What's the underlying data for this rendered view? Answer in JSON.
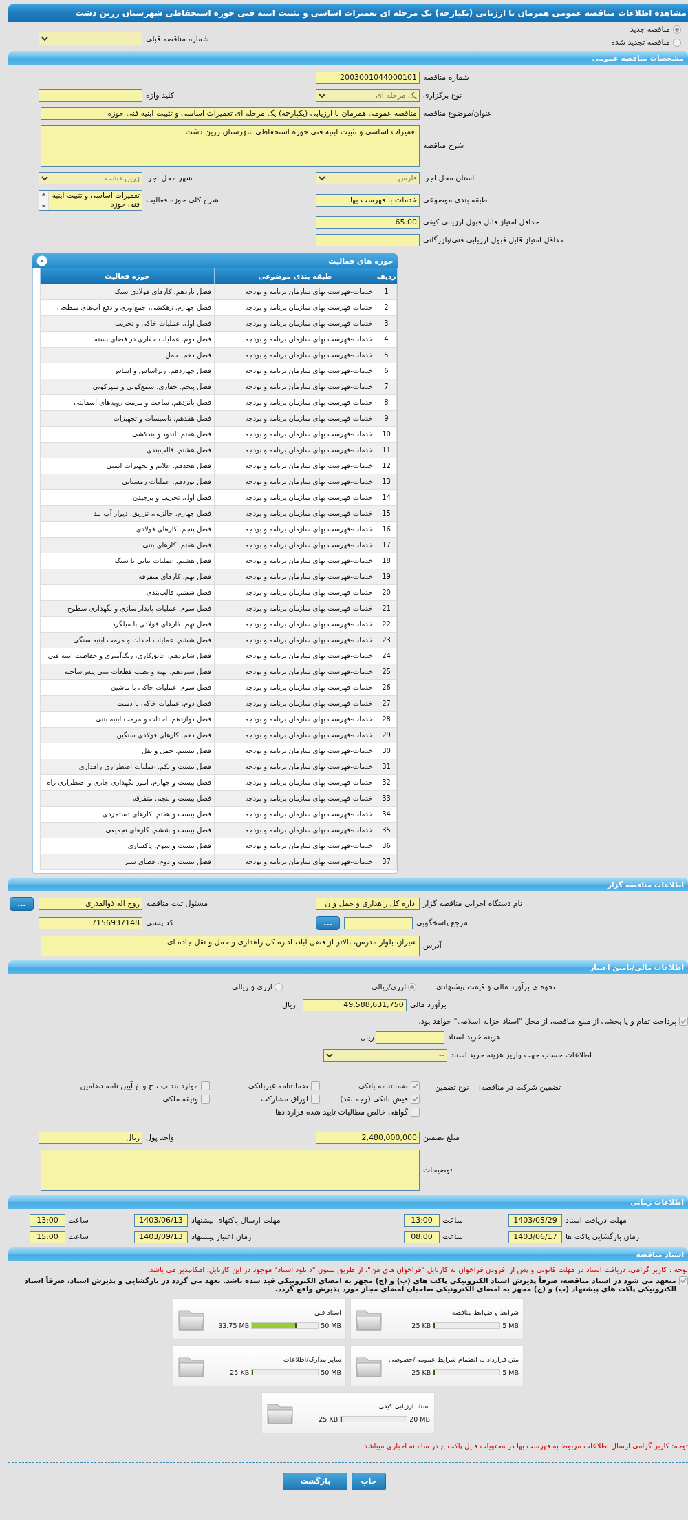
{
  "title": "مشاهده اطلاعات مناقصه عمومی همزمان با ارزیابی (یکپارچه) یک مرحله ای تعمیرات اساسی و تثبیت ابنیه فنی حوزه استحفاظی شهرستان زرین دشت",
  "tender_type": [
    {
      "label": "مناقصه جدید",
      "selected": true
    },
    {
      "label": "مناقصه تجدید شده",
      "selected": false
    }
  ],
  "previous_tender": {
    "label": "شماره مناقصه قبلی",
    "value": "--"
  },
  "general": {
    "title": "مشخصات مناقصه عمومی",
    "rows": [
      [
        {
          "label": "شماره مناقصه",
          "kind": "text",
          "value": "2003001044000101"
        }
      ],
      [
        {
          "label": "نوع برگزاری",
          "kind": "select",
          "value": "یک مرحله ای"
        },
        {
          "label": "کلید واژه",
          "kind": "text"
        }
      ],
      [
        {
          "label": "عنوان/موضوع مناقصه",
          "kind": "wide",
          "value": "مناقصه عمومی همزمان با ارزیابی (یکپارچه) یک مرحله ای تعمیرات اساسی و تثبیت ابنیه فنی حوزه"
        }
      ],
      [
        {
          "label": "شرح مناقصه",
          "kind": "textarea",
          "value": "تعمیرات اساسی و تثبیت ابنیه فنی حوزه استحفاظی شهرستان زرین دشت"
        }
      ],
      [
        {
          "label": "استان محل اجرا",
          "kind": "select",
          "value": "فارس"
        },
        {
          "label": "شهر محل اجرا",
          "kind": "select",
          "value": "زرین دشت"
        }
      ],
      [
        {
          "label": "طبقه بندی موضوعی",
          "kind": "text",
          "value": "خدمات با فهرست بها"
        },
        {
          "label": "شرح کلی حوزه فعالیت",
          "kind": "listbox",
          "value": "تعمیرات اساسی و تثبیت ابنیه فنی حوزه"
        }
      ],
      [
        {
          "label": "حداقل امتیاز قابل قبول ارزیابی کیفی",
          "kind": "text",
          "value": "65.00"
        }
      ],
      [
        {
          "label": "حداقل امتیاز قابل قبول ارزیابی فنی/بازرگانی",
          "kind": "text"
        }
      ]
    ]
  },
  "activities": {
    "title": "حوزه های فعالیت",
    "expanded": true,
    "columns": [
      "ردیف",
      "طبقه بندی موضوعی",
      "حوزه فعالیت"
    ],
    "rows": [
      {
        "no": "1",
        "category": "خدمات-فهرست بهای سازمان برنامه و بودجه",
        "activity": "فصل یازدهم. کارهای فولادی سبک"
      },
      {
        "no": "2",
        "category": "خدمات-فهرست بهای سازمان برنامه و بودجه",
        "activity": "فصل چهارم. زهکشی، جمع‌آوری و دفع آب‌های سطحی"
      },
      {
        "no": "3",
        "category": "خدمات-فهرست بهای سازمان برنامه و بودجه",
        "activity": "فصل اول. عملیات خاکی و تخریب"
      },
      {
        "no": "4",
        "category": "خدمات-فهرست بهای سازمان برنامه و بودجه",
        "activity": "فصل دوم. عملیات حفاری در فضای بسته"
      },
      {
        "no": "5",
        "category": "خدمات-فهرست بهای سازمان برنامه و بودجه",
        "activity": "فصل دهم. حمل"
      },
      {
        "no": "6",
        "category": "خدمات-فهرست بهای سازمان برنامه و بودجه",
        "activity": "فصل چهاردهم. زیراساس و اساس"
      },
      {
        "no": "7",
        "category": "خدمات-فهرست بهای سازمان برنامه و بودجه",
        "activity": "فصل پنجم. حفاری، شمع‌کوبی و سپرکوبی"
      },
      {
        "no": "8",
        "category": "خدمات-فهرست بهای سازمان برنامه و بودجه",
        "activity": "فصل پانزدهم. ساخت و مرمت رویه‌های آسفالتی"
      },
      {
        "no": "9",
        "category": "خدمات-فهرست بهای سازمان برنامه و بودجه",
        "activity": "فصل هفدهم. تاسیسات و تجهیزات"
      },
      {
        "no": "10",
        "category": "خدمات-فهرست بهای سازمان برنامه و بودجه",
        "activity": "فصل هفتم. اندود و بندکشی"
      },
      {
        "no": "11",
        "category": "خدمات-فهرست بهای سازمان برنامه و بودجه",
        "activity": "فصل هشتم. قالب‌بندی"
      },
      {
        "no": "12",
        "category": "خدمات-فهرست بهای سازمان برنامه و بودجه",
        "activity": "فصل هجدهم. علایم و تجهیزات ایمنی"
      },
      {
        "no": "13",
        "category": "خدمات-فهرست بهای سازمان برنامه و بودجه",
        "activity": "فصل نوزدهم. عملیات زمستانی"
      },
      {
        "no": "14",
        "category": "خدمات-فهرست بهای سازمان برنامه و بودجه",
        "activity": "فصل اول. تخریب و برچیدن"
      },
      {
        "no": "15",
        "category": "خدمات-فهرست بهای سازمان برنامه و بودجه",
        "activity": "فصل چهارم. چالزنی، تزریق، دیوار آب بند"
      },
      {
        "no": "16",
        "category": "خدمات-فهرست بهای سازمان برنامه و بودجه",
        "activity": "فصل پنجم. کارهای فولادی"
      },
      {
        "no": "17",
        "category": "خدمات-فهرست بهای سازمان برنامه و بودجه",
        "activity": "فصل هفتم. کارهای بتنی"
      },
      {
        "no": "18",
        "category": "خدمات-فهرست بهای سازمان برنامه و بودجه",
        "activity": "فصل هشتم. عملیات بنایی با سنگ"
      },
      {
        "no": "19",
        "category": "خدمات-فهرست بهای سازمان برنامه و بودجه",
        "activity": "فصل نهم. کارهای متفرقه"
      },
      {
        "no": "20",
        "category": "خدمات-فهرست بهای سازمان برنامه و بودجه",
        "activity": "فصل ششم. قالب‌بندی"
      },
      {
        "no": "21",
        "category": "خدمات-فهرست بهای سازمان برنامه و بودجه",
        "activity": "فصل سوم. عملیات پایدار سازی و نگهداری سطوح"
      },
      {
        "no": "22",
        "category": "خدمات-فهرست بهای سازمان برنامه و بودجه",
        "activity": "فصل نهم. کارهای فولادی با میلگرد"
      },
      {
        "no": "23",
        "category": "خدمات-فهرست بهای سازمان برنامه و بودجه",
        "activity": "فصل ششم.  عملیات احداث و مرمت ابنیه سنگی"
      },
      {
        "no": "24",
        "category": "خدمات-فهرست بهای سازمان برنامه و بودجه",
        "activity": "فصل شانزدهم. عایق‌کاری، رنگ‌آمیزی و حفاظت ابنیه فنی"
      },
      {
        "no": "25",
        "category": "خدمات-فهرست بهای سازمان برنامه و بودجه",
        "activity": "فصل سیزدهم. تهیه و نصب قطعات بتنی پیش‌ساخته"
      },
      {
        "no": "26",
        "category": "خدمات-فهرست بهای سازمان برنامه و بودجه",
        "activity": "فصل سوم. عملیات خاکی با ماشین"
      },
      {
        "no": "27",
        "category": "خدمات-فهرست بهای سازمان برنامه و بودجه",
        "activity": "فصل دوم. عملیات خاکی با دست"
      },
      {
        "no": "28",
        "category": "خدمات-فهرست بهای سازمان برنامه و بودجه",
        "activity": "فصل دوازدهم. احداث و مرمت ابنیه بتنی"
      },
      {
        "no": "29",
        "category": "خدمات-فهرست بهای سازمان برنامه و بودجه",
        "activity": "فصل دهم. کارهای فولادی سنگین"
      },
      {
        "no": "30",
        "category": "خدمات-فهرست بهای سازمان برنامه و بودجه",
        "activity": "فصل بیستم. حمل و نقل"
      },
      {
        "no": "31",
        "category": "خدمات-فهرست بهای سازمان برنامه و بودجه",
        "activity": "فصل بیست و یکم. عملیات اضطراری راهداری"
      },
      {
        "no": "32",
        "category": "خدمات-فهرست بهای سازمان برنامه و بودجه",
        "activity": "فصل بیست و چهارم. امور نگهداری جاری و اضطراری راه"
      },
      {
        "no": "33",
        "category": "خدمات-فهرست بهای سازمان برنامه و بودجه",
        "activity": "فصل بیست و پنجم. متفرقه"
      },
      {
        "no": "34",
        "category": "خدمات-فهرست بهای سازمان برنامه و بودجه",
        "activity": "فصل بیست و هفتم. کارهای دستمزدی"
      },
      {
        "no": "35",
        "category": "خدمات-فهرست بهای سازمان برنامه و بودجه",
        "activity": "فصل بیست و ششم. کارهای تجمیعی"
      },
      {
        "no": "36",
        "category": "خدمات-فهرست بهای سازمان برنامه و بودجه",
        "activity": "فصل بیست و سوم. پاکسازی"
      },
      {
        "no": "37",
        "category": "خدمات-فهرست بهای سازمان برنامه و بودجه",
        "activity": "فصل بیست و دوم. فضای سبز"
      }
    ]
  },
  "organizer": {
    "title": "اطلاعات مناقصه گزار",
    "rows": [
      [
        {
          "label": "نام دستگاه اجرایی مناقصه گزار",
          "kind": "text",
          "value": "اداره کل راهداری و حمل و ن"
        },
        {
          "label": "مسئول ثبت مناقصه",
          "kind": "text",
          "value": "روح اله ذوالقدری",
          "button": "..."
        }
      ],
      [
        {
          "label": "مرجع پاسخگویی",
          "kind": "short",
          "button": "..."
        },
        {
          "label": "کد پستی",
          "kind": "text",
          "value": "7156937148"
        }
      ],
      [
        {
          "label": "آدرس",
          "kind": "address",
          "value": "شیراز، بلوار مدرس، بالاتر از فضل آباد، اداره کل راهداری و حمل و نقل جاده ای"
        }
      ]
    ]
  },
  "finance": {
    "title": "اطلاعات مالی/تامین اعتبار",
    "estimate_method": {
      "label": "نحوه ی برآورد مالی و قیمت پیشنهادی",
      "options": [
        {
          "label": "ارزی/ریالی",
          "selected": true
        },
        {
          "label": "ارزی و ریالی",
          "selected": false
        }
      ]
    },
    "estimate": {
      "label": "برآورد مالی",
      "value": "49,588,631,750",
      "unit": "ریال"
    },
    "treasury": {
      "label": "پرداخت تمام و یا بخشی از مبلغ مناقصه، از محل \"اسناد خزانه اسلامی\" خواهد بود.",
      "checked": true
    },
    "document_fee": {
      "label": "هزینه خرید اسناد",
      "unit": "ریال"
    },
    "fee_account": {
      "label": "اطلاعات حساب جهت واریز هزینه خرید اسناد",
      "value": "--"
    },
    "guarantee": {
      "label": "تضمین شرکت در مناقصه:",
      "type_label": "نوع تضمین",
      "types": [
        {
          "label": "ضمانتنامه بانکی",
          "checked": true
        },
        {
          "label": "ضمانتنامه غیربانکی",
          "checked": false
        },
        {
          "label": "موارد بند پ ، ج و خ آیین نامه تضامین",
          "checked": false
        },
        {
          "label": "فیش بانکی (وجه نقد)",
          "checked": true
        },
        {
          "label": "اوراق مشارکت",
          "checked": false
        },
        {
          "label": "وثیقه ملکی",
          "checked": false
        },
        {
          "label": "گواهی خالص مطالبات تایید شده قراردادها",
          "checked": false
        }
      ]
    },
    "rows": [
      [
        {
          "label": "مبلغ تضمین",
          "kind": "text",
          "value": "2,480,000,000"
        },
        {
          "label": "واحد پول",
          "kind": "text",
          "value": "ریال"
        }
      ],
      [
        {
          "label": "توضیحات",
          "kind": "textarea"
        }
      ]
    ]
  },
  "timing": {
    "title": "اطلاعات زمانی",
    "items": [
      {
        "label": "مهلت دریافت اسناد",
        "date": "1403/05/29",
        "time_label": "ساعت",
        "time": "13:00"
      },
      {
        "label": "مهلت ارسال پاکتهای پیشنهاد",
        "date": "1403/06/13",
        "time_label": "ساعت",
        "time": "13:00"
      },
      {
        "label": "زمان بازگشایی پاکت ها",
        "date": "1403/06/17",
        "time_label": "ساعت",
        "time": "08:00"
      },
      {
        "label": "زمان اعتبار پیشنهاد",
        "date": "1403/09/13",
        "time_label": "ساعت",
        "time": "15:00"
      }
    ]
  },
  "docs": {
    "title": "اسناد مناقصه",
    "notice": "توجه : کاربر گرامی، دریافت اسناد در مهلت قانونی و پس از افزودن فراخوان به کارتابل \"فراخوان های من\"، از طریق ستون \"دانلود اسناد\" موجود در این کارتابل، امکانپذیر می باشد.",
    "commitment": {
      "label": "متعهد می شود در اسناد مناقصه، صرفاً پذیرش اسناد الکترونیکی پاکت های (ب) و (ج) مجهز به امضای الکترونیکی قید شده باشد. تعهد می گردد در بازگشایی و پذیرش اسناد، صرفاً اسناد الکترونیکی پاکت های پیشنهاد (ب) و (ج) مجهز به امضای الکترونیکی صاحبان امضای مجاز مورد پذیرش واقع گردد.",
      "checked": true
    },
    "files": [
      {
        "name": "شرایط و ضوابط مناقصه",
        "used": "25 KB",
        "limit": "5 MB",
        "level": 0.005
      },
      {
        "name": "اسناد فنی",
        "used": "33.75 MB",
        "limit": "50 MB",
        "level": 0.675
      },
      {
        "name": "متن قرارداد به انضمام شرایط عمومی/خصوصی",
        "used": "25 KB",
        "limit": "5 MB",
        "level": 0.005
      },
      {
        "name": "سایر مدارک/اطلاعات",
        "used": "25 KB",
        "limit": "50 MB",
        "level": 0.001
      },
      {
        "name": "اسناد ارزیابی کیفی",
        "used": "25 KB",
        "limit": "20 MB",
        "level": 0.002
      }
    ],
    "footer_notice": "توجه: کاربر گرامی ارسال اطلاعات مربوط به فهرست بها در محتویات فایل پاکت ج در سامانه اجباری میباشد."
  },
  "buttons": [
    {
      "label": "چاپ"
    },
    {
      "label": "بازگشت"
    }
  ]
}
